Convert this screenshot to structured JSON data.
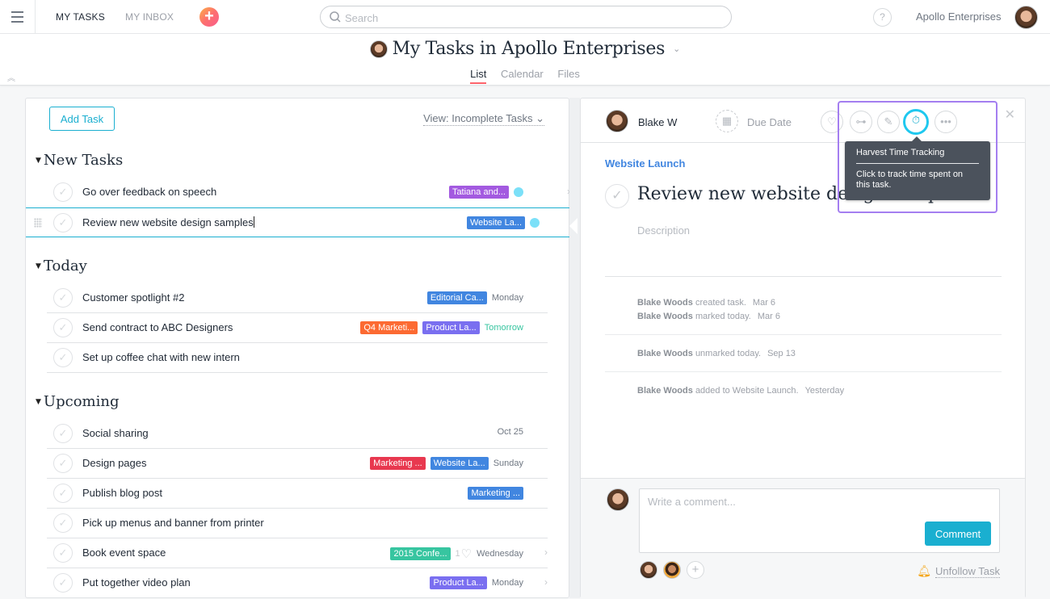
{
  "topbar": {
    "nav": [
      {
        "label": "MY TASKS",
        "active": true
      },
      {
        "label": "MY INBOX",
        "active": false
      }
    ],
    "search_placeholder": "Search",
    "help_label": "?",
    "org_name": "Apollo Enterprises"
  },
  "page": {
    "title": "My Tasks in Apollo Enterprises",
    "tabs": [
      {
        "label": "List",
        "active": true
      },
      {
        "label": "Calendar",
        "active": false
      },
      {
        "label": "Files",
        "active": false
      }
    ]
  },
  "list": {
    "add_task_label": "Add Task",
    "view_label": "View: Incomplete Tasks",
    "sections": [
      {
        "title": "New Tasks",
        "tasks": [
          {
            "name": "Go over feedback on speech",
            "tags": [
              {
                "label": "Tatiana and...",
                "color": "#a35ae0"
              }
            ],
            "dot": true,
            "chevron": true
          },
          {
            "name": "Review new website design samples",
            "tags": [
              {
                "label": "Website La...",
                "color": "#4186e0"
              }
            ],
            "dot": true,
            "selected": true
          }
        ]
      },
      {
        "title": "Today",
        "tasks": [
          {
            "name": "Customer spotlight #2",
            "tags": [
              {
                "label": "Editorial Ca...",
                "color": "#4186e0"
              }
            ],
            "due": "Monday"
          },
          {
            "name": "Send contract to ABC Designers",
            "tags": [
              {
                "label": "Q4 Marketi...",
                "color": "#fc6a32"
              },
              {
                "label": "Product La...",
                "color": "#7a6ff0"
              }
            ],
            "due": "Tomorrow",
            "due_color": "#37c5a0"
          },
          {
            "name": "Set up coffee chat with new intern",
            "tags": []
          }
        ]
      },
      {
        "title": "Upcoming",
        "tasks": [
          {
            "name": "Social sharing",
            "tags": [],
            "due": "Oct 25"
          },
          {
            "name": "Design pages",
            "tags": [
              {
                "label": "Marketing ...",
                "color": "#e8384f"
              },
              {
                "label": "Website La...",
                "color": "#4186e0"
              }
            ],
            "due": "Sunday"
          },
          {
            "name": "Publish blog post",
            "tags": [
              {
                "label": "Marketing ...",
                "color": "#4186e0"
              }
            ]
          },
          {
            "name": "Pick up menus and banner from printer",
            "tags": []
          },
          {
            "name": "Book event space",
            "tags": [
              {
                "label": "2015 Confe...",
                "color": "#37c5a0"
              }
            ],
            "likes": "1",
            "due": "Wednesday",
            "chevron": true
          },
          {
            "name": "Put together video plan",
            "tags": [
              {
                "label": "Product La...",
                "color": "#7a6ff0"
              }
            ],
            "due": "Monday",
            "chevron": true
          }
        ]
      }
    ]
  },
  "detail": {
    "assignee": "Blake W",
    "due_date_label": "Due Date",
    "toolbar_icons": [
      "heart-icon",
      "subtasks-icon",
      "attachment-icon",
      "stopwatch-icon",
      "more-icon"
    ],
    "tooltip": {
      "title": "Harvest Time Tracking",
      "body": "Click to track time spent on this task."
    },
    "project": "Website Launch",
    "title": "Review new website design samples",
    "description_placeholder": "Description",
    "stories": [
      [
        {
          "user": "Blake Woods",
          "action": "created task.",
          "when": "Mar 6"
        },
        {
          "user": "Blake Woods",
          "action": "marked today.",
          "when": "Mar 6"
        }
      ],
      [
        {
          "user": "Blake Woods",
          "action": "unmarked today.",
          "when": "Sep 13"
        }
      ],
      [
        {
          "user": "Blake Woods",
          "action": "added to Website Launch.",
          "when": "Yesterday"
        }
      ]
    ],
    "comment_placeholder": "Write a comment...",
    "comment_button": "Comment",
    "unfollow_label": "Unfollow Task"
  },
  "colors": {
    "accent": "#1aafd0",
    "tab_underline": "#fc636b",
    "highlight": "#a47ef0",
    "tooltip_bg": "#4b525c"
  }
}
